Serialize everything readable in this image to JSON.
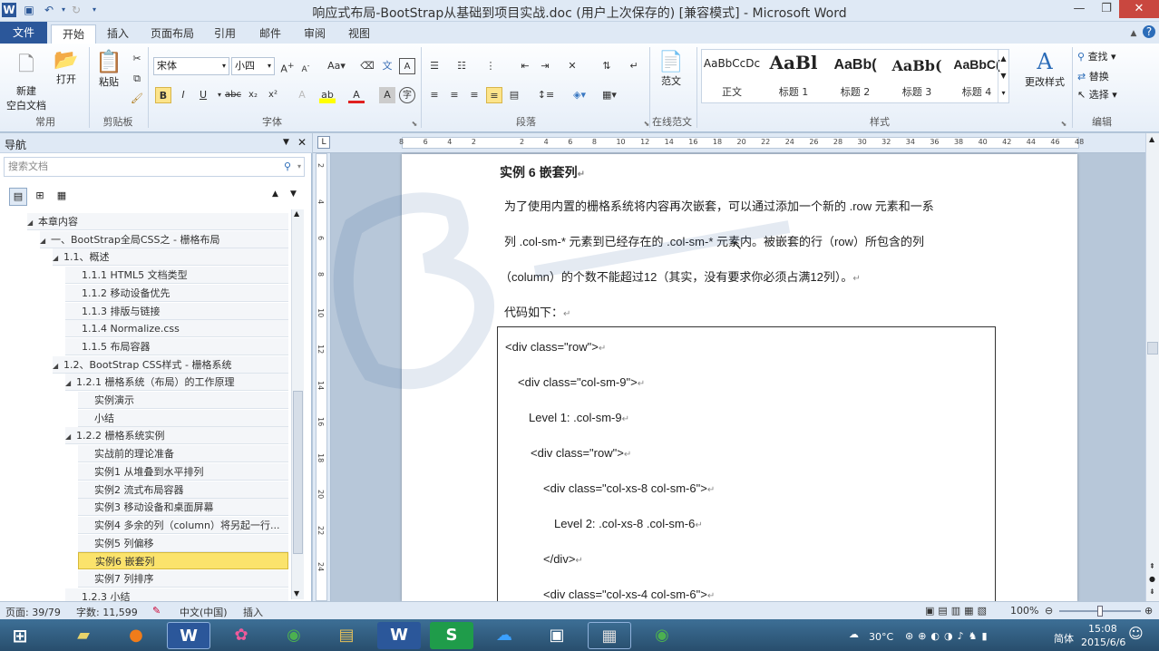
{
  "window": {
    "title": "响应式布局-BootStrap从基础到项目实战.doc (用户上次保存的) [兼容模式] - Microsoft Word"
  },
  "tabs": [
    "文件",
    "开始",
    "插入",
    "页面布局",
    "引用",
    "邮件",
    "审阅",
    "视图"
  ],
  "ribbon": {
    "new_doc": "新建\n空白文档",
    "new_doc_l1": "新建",
    "new_doc_l2": "空白文档",
    "open": "打开",
    "group_common": "常用",
    "paste": "粘贴",
    "group_clipboard": "剪贴板",
    "font_name": "宋体",
    "font_size": "小四",
    "group_font": "字体",
    "group_paragraph": "段落",
    "fanwen": "范文",
    "group_online": "在线范文",
    "styles": [
      {
        "preview": "AaBbCcDc",
        "label": "正文"
      },
      {
        "preview": "AaBl",
        "label": "标题 1"
      },
      {
        "preview": "AaBb(",
        "label": "标题 2"
      },
      {
        "preview": "AaBb(",
        "label": "标题 3"
      },
      {
        "preview": "AaBbC(",
        "label": "标题 4"
      }
    ],
    "change_style": "更改样式",
    "group_styles": "样式",
    "find": "查找",
    "replace": "替换",
    "select": "选择",
    "group_edit": "编辑"
  },
  "nav": {
    "title": "导航",
    "search_placeholder": "搜索文档",
    "tree": [
      {
        "label": "本章内容",
        "level": 0,
        "exp": true
      },
      {
        "label": "一、BootStrap全局CSS之 - 栅格布局",
        "level": 1,
        "exp": true
      },
      {
        "label": "1.1、概述",
        "level": 2,
        "exp": true
      },
      {
        "label": "1.1.1  HTML5 文档类型",
        "level": 3
      },
      {
        "label": "1.1.2 移动设备优先",
        "level": 3
      },
      {
        "label": "1.1.3 排版与链接",
        "level": 3
      },
      {
        "label": "1.1.4  Normalize.css",
        "level": 3
      },
      {
        "label": "1.1.5 布局容器",
        "level": 3
      },
      {
        "label": "1.2、BootStrap CSS样式 - 栅格系统",
        "level": 2,
        "exp": true
      },
      {
        "label": "1.2.1 栅格系统（布局）的工作原理",
        "level": 3,
        "exp": true
      },
      {
        "label": "实例演示",
        "level": 4
      },
      {
        "label": "小结",
        "level": 4
      },
      {
        "label": "1.2.2 栅格系统实例",
        "level": 3,
        "exp": true
      },
      {
        "label": "实战前的理论准备",
        "level": 4
      },
      {
        "label": "实例1 从堆叠到水平排列",
        "level": 4
      },
      {
        "label": "实例2  流式布局容器",
        "level": 4
      },
      {
        "label": "实例3 移动设备和桌面屏幕",
        "level": 4
      },
      {
        "label": "实例4 多余的列（column）将另起一行...",
        "level": 4
      },
      {
        "label": "实例5 列偏移",
        "level": 4
      },
      {
        "label": "实例6 嵌套列",
        "level": 4,
        "selected": true
      },
      {
        "label": "实例7 列排序",
        "level": 4
      },
      {
        "label": "1.2.3  小结",
        "level": 3
      }
    ]
  },
  "ruler": {
    "ticks": [
      "8",
      "6",
      "4",
      "2",
      "",
      "2",
      "4",
      "6",
      "8",
      "10",
      "12",
      "14",
      "16",
      "18",
      "20",
      "22",
      "24",
      "26",
      "28",
      "30",
      "32",
      "34",
      "36",
      "38",
      "40",
      "42",
      "44",
      "46",
      "48"
    ]
  },
  "vruler": [
    "2",
    "4",
    "6",
    "8",
    "10",
    "12",
    "14",
    "16",
    "18",
    "20",
    "22",
    "24"
  ],
  "document": {
    "heading": "实例 6  嵌套列",
    "para1": "为了使用内置的栅格系统将内容再次嵌套，可以通过添加一个新的 .row 元素和一系",
    "para2": "列 .col-sm-* 元素到已经存在的 .col-sm-* 元素内。被嵌套的行（row）所包含的列",
    "para3": "（column）的个数不能超过12（其实，没有要求你必须占满12列）。",
    "code_intro": "代码如下：",
    "code_lines": [
      "<div class=\"row\">",
      "<div class=\"col-sm-9\">",
      "Level 1: .col-sm-9",
      "<div class=\"row\">",
      "<div class=\"col-xs-8 col-sm-6\">",
      "Level 2: .col-xs-8 .col-sm-6",
      "</div>",
      "<div class=\"col-xs-4 col-sm-6\">"
    ],
    "para_mark": "↵"
  },
  "status": {
    "page": "页面: 39/79",
    "words": "字数: 11,599",
    "lang": "中文(中国)",
    "mode": "插入",
    "zoom": "100%"
  },
  "taskbar": {
    "apps": [
      "W",
      "S"
    ],
    "temp": "30°C",
    "ime": "简体",
    "time": "15:08",
    "date": "2015/6/6"
  },
  "colors": {
    "accent": "#2b579a",
    "selected": "#fbe36c"
  }
}
